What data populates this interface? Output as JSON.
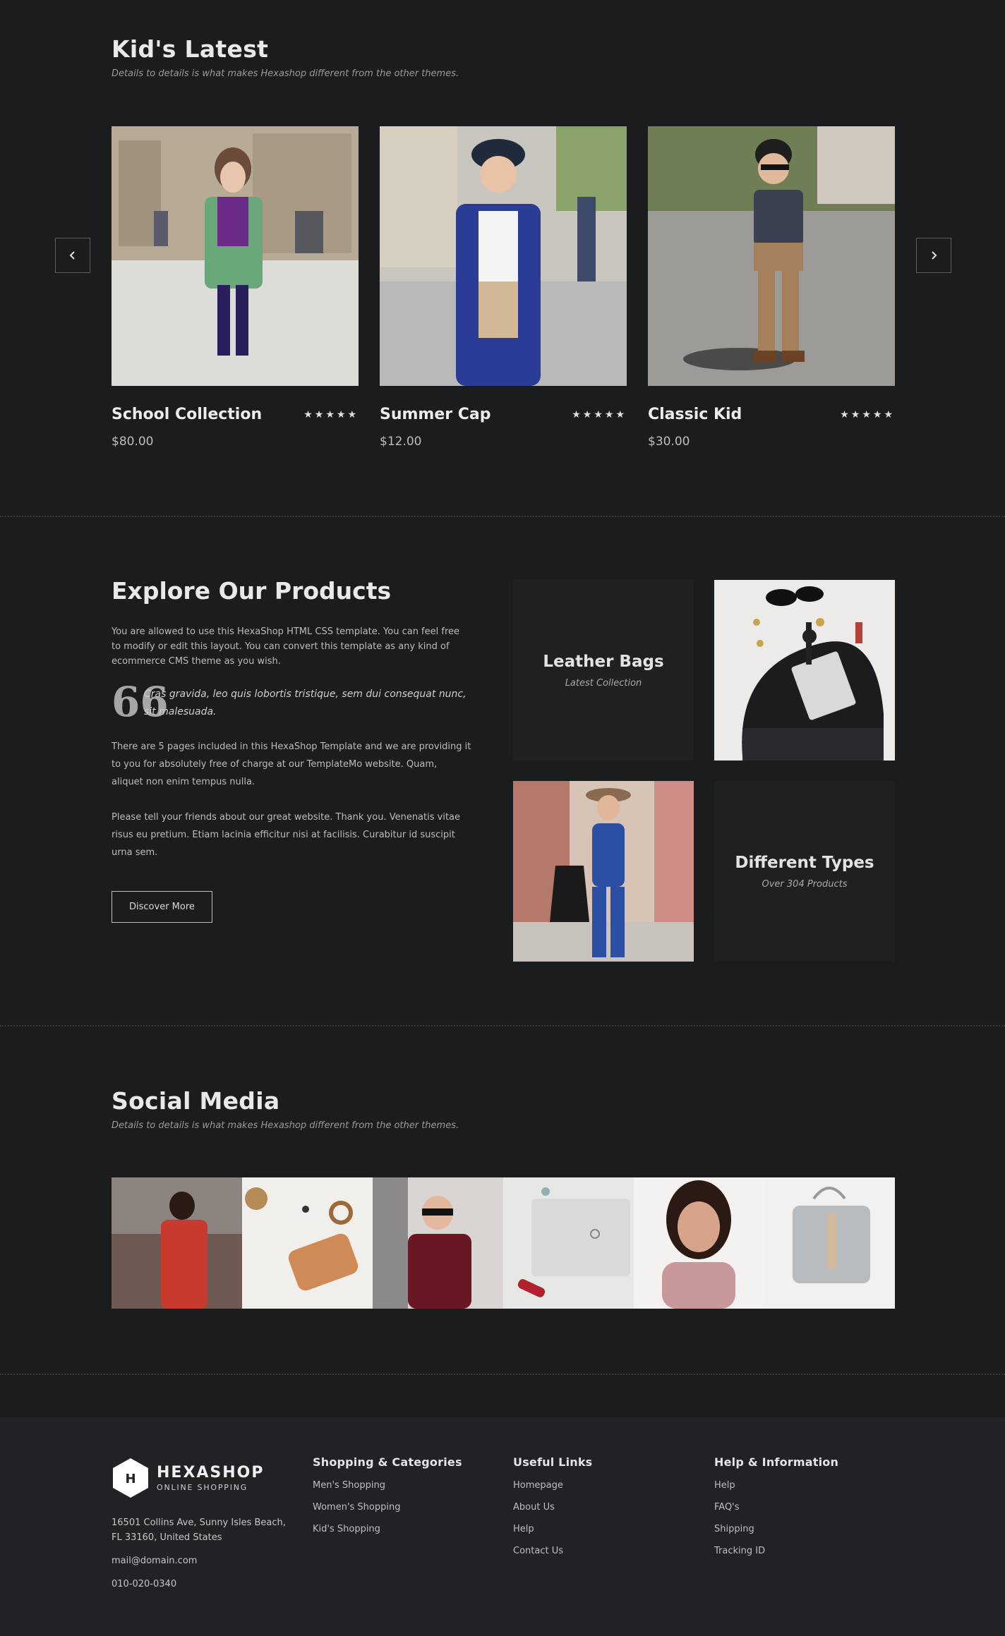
{
  "kids": {
    "title": "Kid's Latest",
    "subtitle": "Details to details is what makes Hexashop different from the other themes.",
    "products": [
      {
        "name": "School Collection",
        "price": "$80.00",
        "rating": 5
      },
      {
        "name": "Summer Cap",
        "price": "$12.00",
        "rating": 5
      },
      {
        "name": "Classic Kid",
        "price": "$30.00",
        "rating": 5
      }
    ],
    "stars": "★★★★★"
  },
  "explore": {
    "title": "Explore Our Products",
    "para1": "You are allowed to use this HexaShop HTML CSS template. You can feel free to modify or edit this layout. You can convert this template as any kind of ecommerce CMS theme as you wish.",
    "quote_mark": "66",
    "quote": "Cras gravida, leo quis lobortis tristique, sem dui consequat nunc, sit malesuada.",
    "para2": "There are 5 pages included in this HexaShop Template and we are providing it to you for absolutely free of charge at our TemplateMo website. Quam, aliquet non enim tempus nulla.",
    "para3": "Please tell your friends about our great website. Thank you. Venenatis vitae risus eu pretium. Etiam lacinia efficitur nisi at facilisis. Curabitur id suscipit urna sem.",
    "button": "Discover More",
    "tile1_title": "Leather Bags",
    "tile1_sub": "Latest Collection",
    "tile2_title": "Different Types",
    "tile2_sub": "Over 304 Products"
  },
  "social": {
    "title": "Social Media",
    "subtitle": "Details to details is what makes Hexashop different from the other themes."
  },
  "footer": {
    "logo_letter": "H",
    "logo_name": "HEXASHOP",
    "logo_tag": "ONLINE SHOPPING",
    "address_line1": "16501 Collins Ave, Sunny Isles Beach,",
    "address_line2": "FL 33160, United States",
    "email": "mail@domain.com",
    "phone": "010-020-0340",
    "col1_title": "Shopping & Categories",
    "col1_links": [
      "Men's Shopping",
      "Women's Shopping",
      "Kid's Shopping"
    ],
    "col2_title": "Useful Links",
    "col2_links": [
      "Homepage",
      "About Us",
      "Help",
      "Contact Us"
    ],
    "col3_title": "Help & Information",
    "col3_links": [
      "Help",
      "FAQ's",
      "Shipping",
      "Tracking ID"
    ]
  }
}
